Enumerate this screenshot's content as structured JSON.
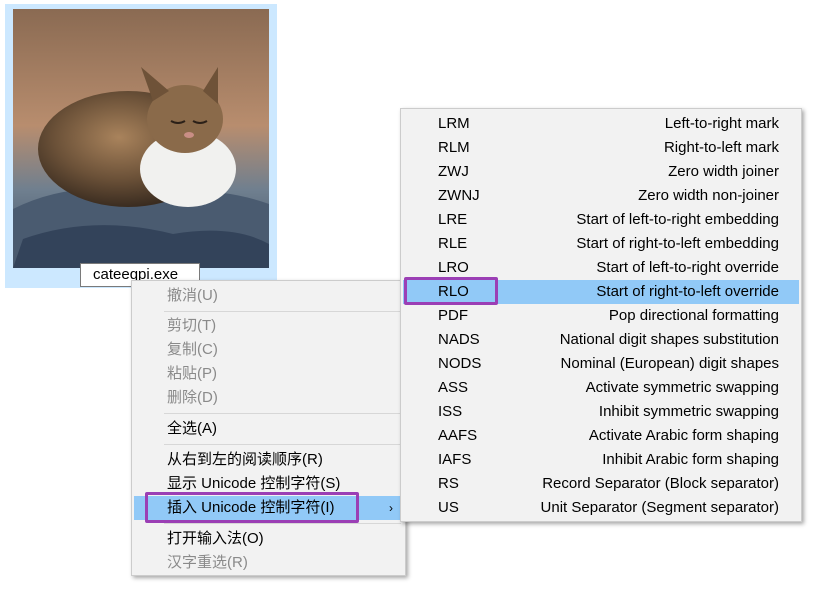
{
  "file": {
    "name": "cateeqpi.exe"
  },
  "context_menu": {
    "items": [
      {
        "label": "撤消(U)",
        "enabled": false
      },
      {
        "label": "剪切(T)",
        "enabled": false
      },
      {
        "label": "复制(C)",
        "enabled": false
      },
      {
        "label": "粘贴(P)",
        "enabled": false
      },
      {
        "label": "删除(D)",
        "enabled": false
      },
      {
        "label": "全选(A)",
        "enabled": true
      },
      {
        "label": "从右到左的阅读顺序(R)",
        "enabled": true
      },
      {
        "label": "显示 Unicode 控制字符(S)",
        "enabled": true
      },
      {
        "label": "插入 Unicode 控制字符(I)",
        "enabled": true,
        "highlighted": true,
        "has_submenu": true
      },
      {
        "label": "打开输入法(O)",
        "enabled": true
      },
      {
        "label": "汉字重选(R)",
        "enabled": false
      }
    ],
    "submenu_arrow": "›"
  },
  "submenu": {
    "items": [
      {
        "code": "LRM",
        "desc": "Left-to-right mark"
      },
      {
        "code": "RLM",
        "desc": "Right-to-left mark"
      },
      {
        "code": "ZWJ",
        "desc": "Zero width joiner"
      },
      {
        "code": "ZWNJ",
        "desc": "Zero width non-joiner"
      },
      {
        "code": "LRE",
        "desc": "Start of left-to-right embedding"
      },
      {
        "code": "RLE",
        "desc": "Start of right-to-left embedding"
      },
      {
        "code": "LRO",
        "desc": "Start of left-to-right override"
      },
      {
        "code": "RLO",
        "desc": "Start of right-to-left override",
        "highlighted": true
      },
      {
        "code": "PDF",
        "desc": "Pop directional formatting"
      },
      {
        "code": "NADS",
        "desc": "National digit shapes substitution"
      },
      {
        "code": "NODS",
        "desc": "Nominal (European) digit shapes"
      },
      {
        "code": "ASS",
        "desc": "Activate symmetric swapping"
      },
      {
        "code": "ISS",
        "desc": "Inhibit symmetric swapping"
      },
      {
        "code": "AAFS",
        "desc": "Activate Arabic form shaping"
      },
      {
        "code": "IAFS",
        "desc": "Inhibit Arabic form shaping"
      },
      {
        "code": "RS",
        "desc": "Record Separator (Block separator)"
      },
      {
        "code": "US",
        "desc": "Unit Separator (Segment separator)"
      }
    ]
  },
  "colors": {
    "highlight": "#91c9f7",
    "menu_bg": "#f2f2f2",
    "callout": "#9b3fb5",
    "selection_bg": "#cce8ff"
  }
}
